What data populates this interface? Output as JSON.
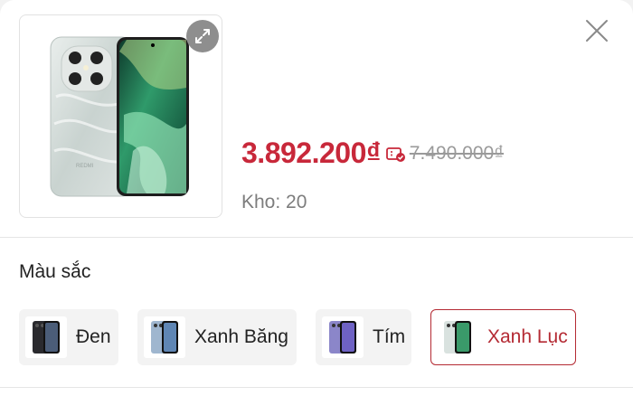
{
  "product": {
    "price": "3.892.200₫",
    "old_price": "7.490.000₫",
    "stock": "Kho: 20",
    "image_icon": "phone-product-image",
    "brand_mark": "REDMI"
  },
  "colors": {
    "heading": "Màu sắc",
    "options": [
      {
        "label": "Đen",
        "selected": false,
        "tone": "#2a2a2e"
      },
      {
        "label": "Xanh Băng",
        "selected": false,
        "tone": "#9fb6cf"
      },
      {
        "label": "Tím",
        "selected": false,
        "tone": "#8b86c9"
      },
      {
        "label": "Xanh Lục",
        "selected": true,
        "tone": "#6fae86"
      }
    ]
  },
  "theme": {
    "accent": "#c8283a",
    "selected_border": "#b42a33"
  }
}
